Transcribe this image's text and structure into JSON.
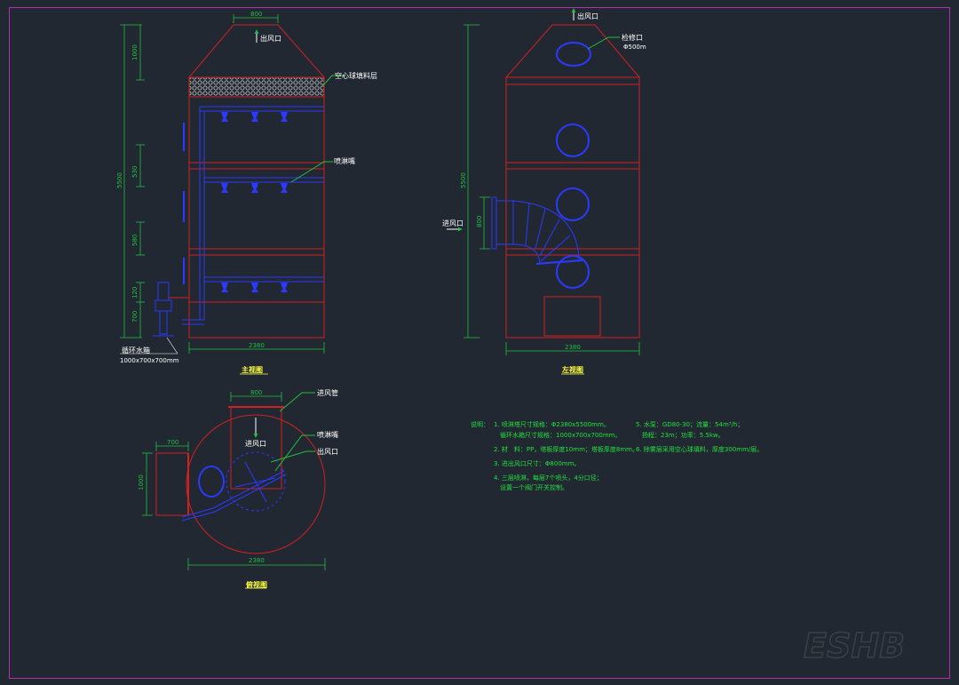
{
  "colors": {
    "background": "#222831",
    "frame": "#b030b0",
    "tower": "#d02020",
    "pipe": "#2a3aff",
    "dimension": "#20c040",
    "text": "#ffffff",
    "caption": "#ffff40",
    "note": "#20e040",
    "packing": "#c8c8c8"
  },
  "front": {
    "caption": "主视图",
    "dims": {
      "top_width": "800",
      "bottom_width": "2380",
      "d1000": "1000",
      "d5500": "5500",
      "d530": "530",
      "d580": "580",
      "d120": "120",
      "d700": "700"
    },
    "labels": {
      "outlet": "出风口",
      "packing": "空心球填料层",
      "nozzle": "喷淋嘴",
      "tank": "循环水箱",
      "tank_size": "1000x700x700mm"
    }
  },
  "side": {
    "caption": "左视图",
    "dims": {
      "d5500": "5500",
      "d800": "800",
      "bottom_width": "2380"
    },
    "labels": {
      "outlet": "出风口",
      "inspection": "检修口",
      "inspection_size": "Φ500m",
      "inlet": "进风口"
    }
  },
  "top": {
    "caption": "俯视图",
    "dims": {
      "d800": "800",
      "d700": "700",
      "d1000": "1000",
      "d2380": "2380"
    },
    "labels": {
      "inlet_pipe": "进风管",
      "nozzle": "喷淋嘴",
      "outlet": "出风口",
      "inlet": "进风口"
    }
  },
  "notes": {
    "heading": "说明：",
    "n1a": "1. 喷淋塔尺寸规格：Φ2380x5500mm。",
    "n1b": "循环水箱尺寸规格：1000x700x700mm。",
    "n2": "2. 材　料：PP，塔板厚度10mm；塔板厚度8mm。",
    "n3": "3. 进出风口尺寸：Φ800mm。",
    "n4a": "4. 三层喷淋，每层7个喷头，4分口径；",
    "n4b": "设置一个阀门开关控制。",
    "n5a": "5. 水泵：GD80-30；流量：54m³/h；",
    "n5b": "扬程：23m；功率：5.5kw。",
    "n6": "6. 除雾层采用空心球填料，厚度300mm/层。"
  },
  "watermark": "ESHB"
}
